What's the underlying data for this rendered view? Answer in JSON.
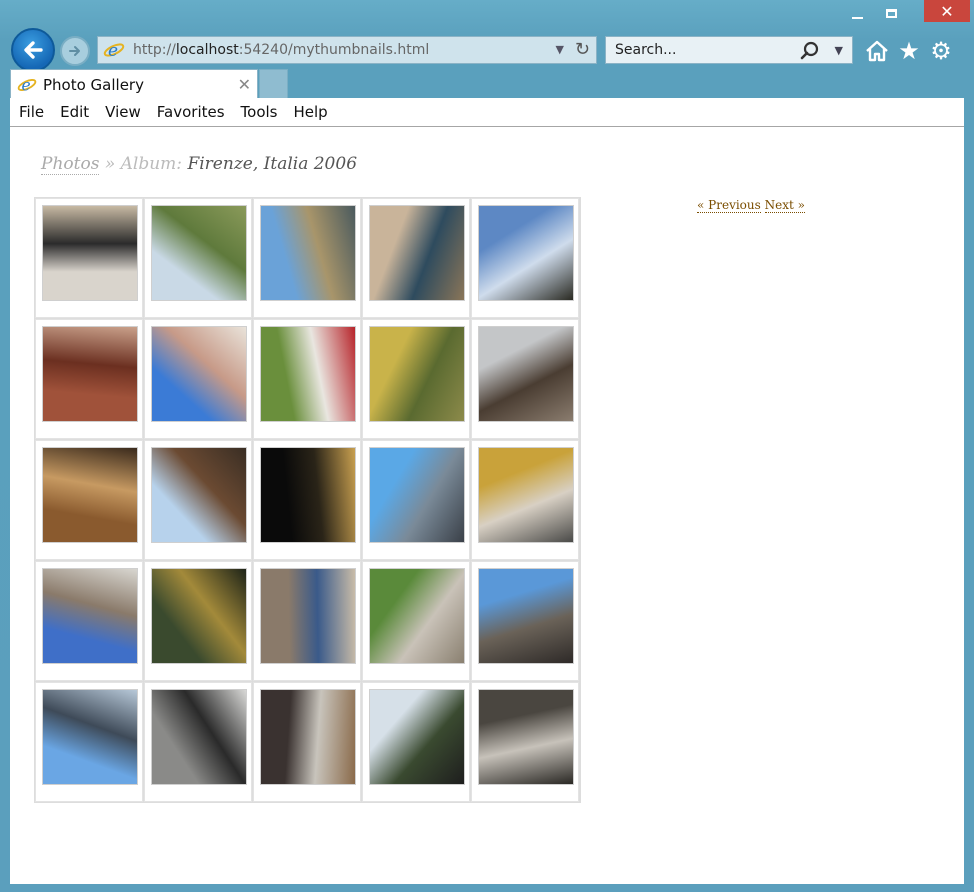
{
  "window": {
    "controls": {
      "minimize": "minimize",
      "maximize": "maximize",
      "close": "✕"
    }
  },
  "nav": {
    "url_prefix": "http://",
    "url_host": "localhost",
    "url_rest": ":54240/mythumbnails.html",
    "search_placeholder": "Search..."
  },
  "tab": {
    "title": "Photo Gallery"
  },
  "menu": [
    "File",
    "Edit",
    "View",
    "Favorites",
    "Tools",
    "Help"
  ],
  "breadcrumb": {
    "root": "Photos",
    "separator": "»",
    "album_label": "Album:",
    "album_name": "Firenze, Italia 2006"
  },
  "pager": {
    "previous": "« Previous",
    "next": "Next »"
  },
  "thumbnails": [
    {
      "subject": "graffiti wall",
      "colors": [
        "#d9d4cc",
        "#2b2b2b",
        "#c7b9a3"
      ]
    },
    {
      "subject": "tuscan countryside",
      "colors": [
        "#c9d9e6",
        "#5f7a3c",
        "#8a9a5a"
      ]
    },
    {
      "subject": "arno river",
      "colors": [
        "#6aa2d8",
        "#a8956a",
        "#4a5a5e"
      ]
    },
    {
      "subject": "perseus statue",
      "colors": [
        "#c9b49a",
        "#2e4b5e",
        "#8a7558"
      ]
    },
    {
      "subject": "palm tree sky",
      "colors": [
        "#5d88c4",
        "#cfdcec",
        "#2a2a22"
      ]
    },
    {
      "subject": "brick wall sign",
      "colors": [
        "#a0523a",
        "#6b2f20",
        "#c9a08a"
      ]
    },
    {
      "subject": "duomo dome",
      "colors": [
        "#3b7bd6",
        "#c79a88",
        "#e9e3da"
      ]
    },
    {
      "subject": "road sign",
      "colors": [
        "#6a8f3c",
        "#e9e6e0",
        "#b7242a"
      ]
    },
    {
      "subject": "yellow facade",
      "colors": [
        "#c9b34a",
        "#5a6a30",
        "#8c8a4a"
      ]
    },
    {
      "subject": "cathedral facade",
      "colors": [
        "#c4c6c8",
        "#4a3d32",
        "#8a7c6e"
      ]
    },
    {
      "subject": "wine barrels",
      "colors": [
        "#8a5a2e",
        "#c79a62",
        "#3a2a1c"
      ]
    },
    {
      "subject": "stone tower",
      "colors": [
        "#b7d2ec",
        "#6b4a32",
        "#3a2e24"
      ]
    },
    {
      "subject": "night river",
      "colors": [
        "#0a0a0a",
        "#2a2418",
        "#c9a050"
      ]
    },
    {
      "subject": "piazza column",
      "colors": [
        "#5aa8e6",
        "#7a8a98",
        "#3a4048"
      ]
    },
    {
      "subject": "narrow street",
      "colors": [
        "#c9a23a",
        "#d8d0c4",
        "#4a4a48"
      ]
    },
    {
      "subject": "david statue",
      "colors": [
        "#3f6fc8",
        "#8a7a6a",
        "#d8d6d0"
      ]
    },
    {
      "subject": "bronze doors",
      "colors": [
        "#3a4a2e",
        "#a38a3a",
        "#1e2418"
      ]
    },
    {
      "subject": "lunette relief",
      "colors": [
        "#8a7a6a",
        "#3a5a8a",
        "#c9bca8"
      ]
    },
    {
      "subject": "cloister garden",
      "colors": [
        "#5a8a3a",
        "#c9c2b8",
        "#8a8070"
      ]
    },
    {
      "subject": "street people",
      "colors": [
        "#5a98d8",
        "#6a6258",
        "#2e2a28"
      ]
    },
    {
      "subject": "bell tower",
      "colors": [
        "#6aa6e4",
        "#3e4a58",
        "#b7c8d8"
      ]
    },
    {
      "subject": "statues interior",
      "colors": [
        "#8a8a88",
        "#2a2a2a",
        "#d8d8d6"
      ]
    },
    {
      "subject": "wine glasses",
      "colors": [
        "#3a3230",
        "#c8c4bc",
        "#8a6a4a"
      ]
    },
    {
      "subject": "woman hillside",
      "colors": [
        "#d6e0e8",
        "#3a4a30",
        "#1e1e1e"
      ]
    },
    {
      "subject": "courtyard arches",
      "colors": [
        "#4a4640",
        "#c7c2ba",
        "#2a2824"
      ]
    }
  ]
}
